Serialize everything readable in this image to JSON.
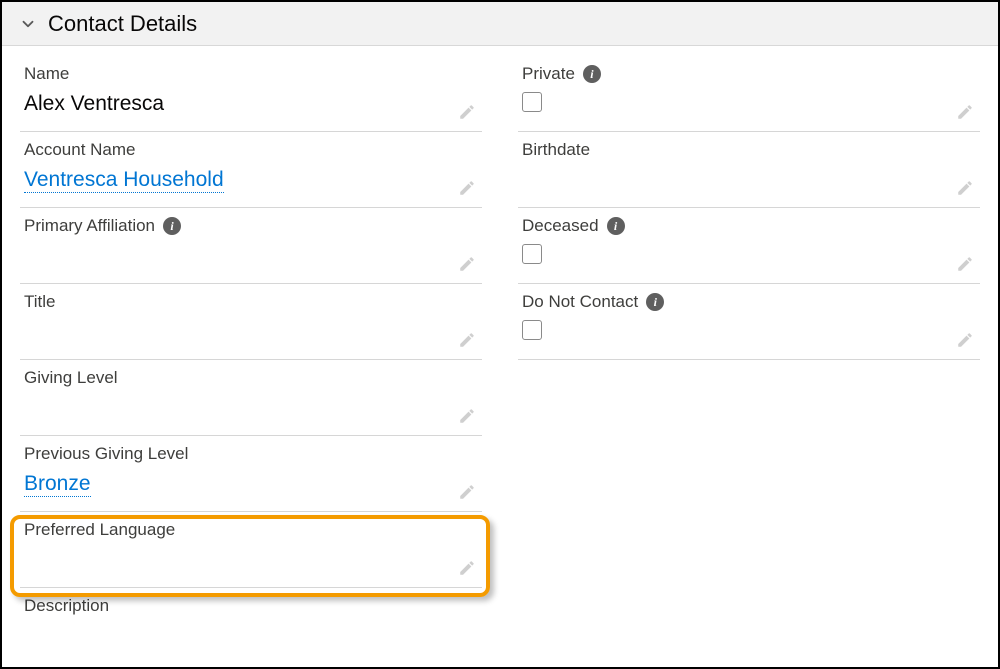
{
  "section": {
    "title": "Contact Details"
  },
  "left": {
    "name": {
      "label": "Name",
      "value": "Alex Ventresca"
    },
    "accountName": {
      "label": "Account Name",
      "value": "Ventresca Household"
    },
    "primaryAffiliation": {
      "label": "Primary Affiliation",
      "value": ""
    },
    "title": {
      "label": "Title",
      "value": ""
    },
    "givingLevel": {
      "label": "Giving Level",
      "value": ""
    },
    "prevGivingLevel": {
      "label": "Previous Giving Level",
      "value": "Bronze"
    },
    "preferredLanguage": {
      "label": "Preferred Language",
      "value": ""
    },
    "description": {
      "label": "Description",
      "value": ""
    }
  },
  "right": {
    "private": {
      "label": "Private"
    },
    "birthdate": {
      "label": "Birthdate",
      "value": ""
    },
    "deceased": {
      "label": "Deceased"
    },
    "doNotContact": {
      "label": "Do Not Contact"
    }
  }
}
